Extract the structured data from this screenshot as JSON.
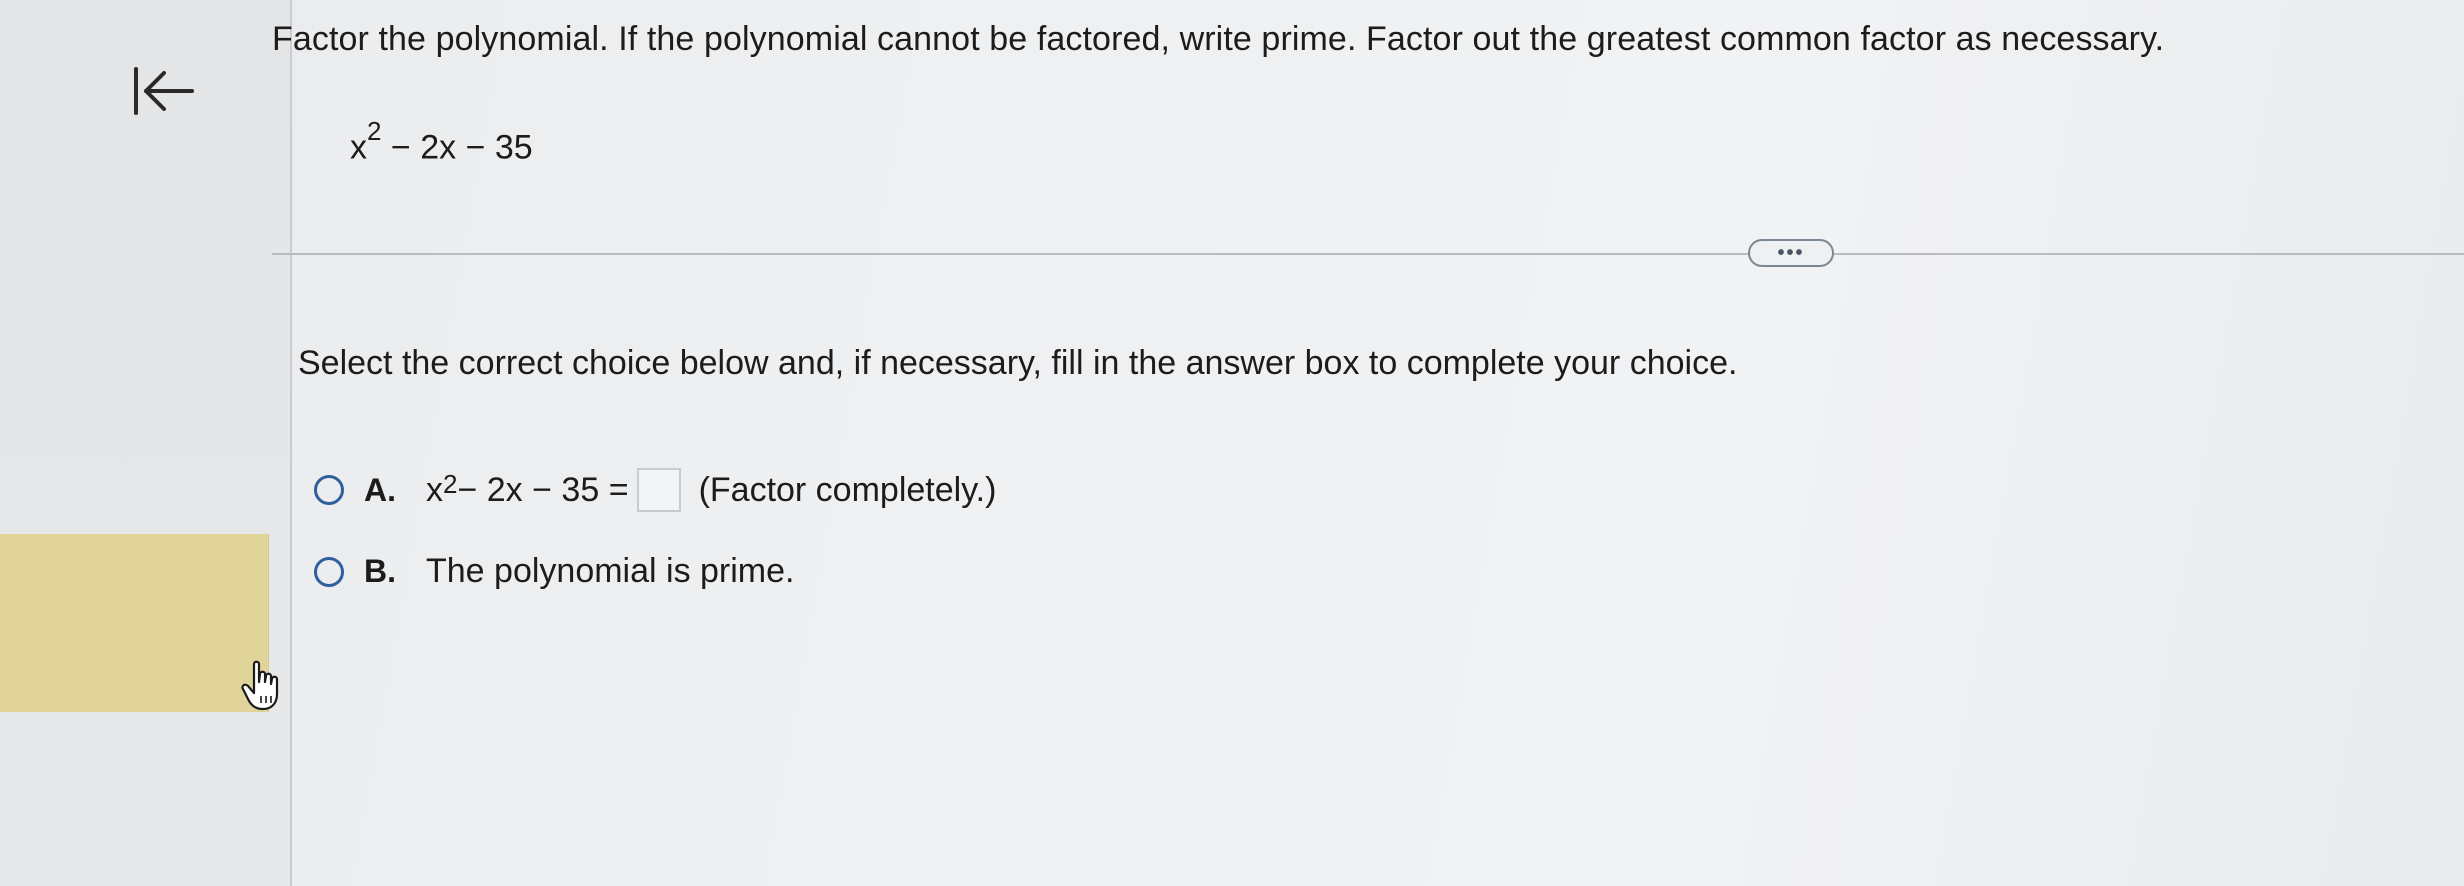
{
  "instruction": "Factor the polynomial. If the polynomial cannot be factored, write prime. Factor out the greatest common factor as necessary.",
  "problem": {
    "base": "x",
    "exponent": "2",
    "rest": " − 2x − 35"
  },
  "more_button": {
    "label": "•••"
  },
  "prompt": "Select the correct choice below and, if necessary, fill in the answer box to complete your choice.",
  "choices": [
    {
      "letter": "A.",
      "expr_base": "x",
      "expr_exponent": "2",
      "expr_rest": " − 2x − 35 =",
      "answer_value": "",
      "note": "(Factor completely.)"
    },
    {
      "letter": "B.",
      "text": "The polynomial is prime."
    }
  ],
  "colors": {
    "radio_border": "#2f5f9c",
    "highlight": "#e1d49b",
    "background": "#eef0f2"
  },
  "icons": {
    "back": "back-to-start-icon",
    "cursor": "hand-pointer-icon"
  }
}
